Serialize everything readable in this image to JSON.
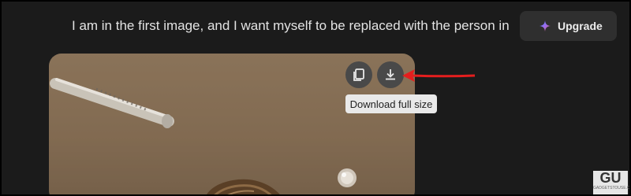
{
  "chat": {
    "prompt_text": "I am in the first image, and I want myself to be replaced with the person in"
  },
  "header": {
    "upgrade_label": "Upgrade",
    "upgrade_icon": "sparkle-icon"
  },
  "image_actions": {
    "copy_icon": "copy-icon",
    "download_icon": "download-icon",
    "tooltip_text": "Download full size"
  },
  "annotation": {
    "arrow_color": "#e41e1e"
  },
  "watermark": {
    "mark_text": "GU",
    "site_text": "GADGETSTOUSE.COM"
  },
  "colors": {
    "background": "#1b1b1b",
    "button_bg": "#2f2f2f",
    "icon_button_bg": "#494949",
    "tooltip_bg": "#e9e9e9"
  }
}
